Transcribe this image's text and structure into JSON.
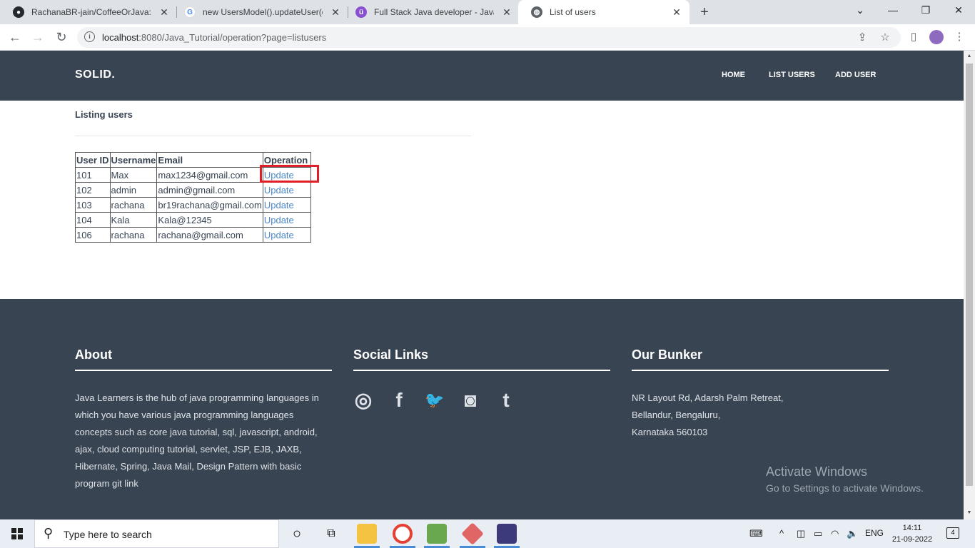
{
  "browser": {
    "tabs": [
      {
        "title": "RachanaBR-jain/CoffeeOrJava: Th",
        "icon": "github-icon"
      },
      {
        "title": "new UsersModel().updateUser(da",
        "icon": "google-icon"
      },
      {
        "title": "Full Stack Java developer - Java -",
        "icon": "udemy-icon"
      },
      {
        "title": "List of users",
        "icon": "globe-icon"
      }
    ],
    "address": {
      "host": "localhost",
      "rest": ":8080/Java_Tutorial/operation?page=listusers"
    }
  },
  "site": {
    "brand": "SOLID.",
    "nav": [
      "HOME",
      "LIST USERS",
      "ADD USER"
    ],
    "listing_title": "Listing users",
    "table": {
      "headers": [
        "User ID",
        "Username",
        "Email",
        "Operation"
      ],
      "rows": [
        [
          "101",
          "Max",
          "max1234@gmail.com",
          "Update"
        ],
        [
          "102",
          "admin",
          "admin@gmail.com",
          "Update"
        ],
        [
          "103",
          "rachana",
          "br19rachana@gmail.com",
          "Update"
        ],
        [
          "104",
          "Kala",
          "Kala@12345",
          "Update"
        ],
        [
          "106",
          "rachana",
          "rachana@gmail.com",
          "Update"
        ]
      ]
    },
    "footer": {
      "about_title": "About",
      "about_text": "Java Learners is the hub of java programming languages in which you have various java programming languages concepts such as core java tutorial, sql, javascript, android, ajax, cloud computing tutorial, servlet, JSP, EJB, JAXB, Hibernate, Spring, Java Mail, Design Pattern with basic program git link",
      "social_title": "Social Links",
      "social_icons": [
        "dribbble-icon",
        "facebook-icon",
        "twitter-icon",
        "instagram-icon",
        "tumblr-icon"
      ],
      "bunker_title": "Our Bunker",
      "address_lines": [
        "NR Layout Rd, Adarsh Palm Retreat,",
        "Bellandur, Bengaluru,",
        "Karnataka 560103"
      ]
    }
  },
  "watermark": {
    "line1": "Activate Windows",
    "line2": "Go to Settings to activate Windows."
  },
  "taskbar": {
    "search_placeholder": "Type here to search",
    "lang": "ENG",
    "time": "14:11",
    "date": "21-09-2022",
    "notifications": "4"
  },
  "colors": {
    "header_bg": "#384452",
    "link": "#4a86c8",
    "highlight": "#e01e26"
  }
}
